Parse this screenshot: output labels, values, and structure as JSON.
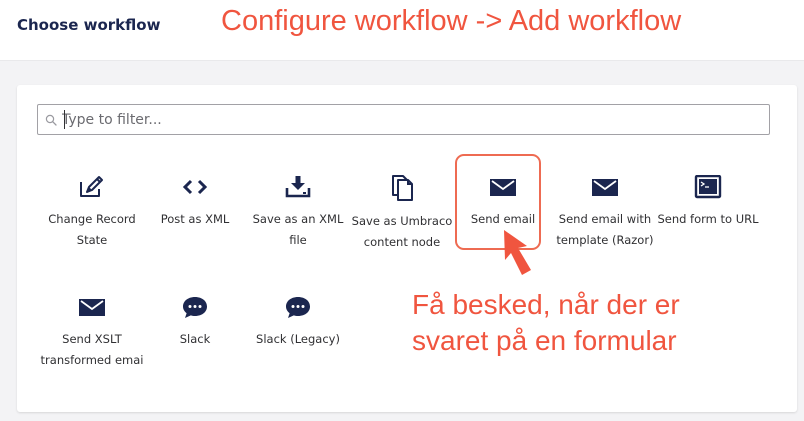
{
  "header": {
    "title": "Choose workflow"
  },
  "annotations": {
    "top": "Configure workflow -> Add workflow",
    "bottom_line1": "Få besked, når der er",
    "bottom_line2": "svaret på en formular"
  },
  "filter": {
    "placeholder": "Type to filter...",
    "value": "",
    "icon": "search-icon"
  },
  "workflows": [
    {
      "label_line1": "Change Record",
      "label_line2": "State",
      "icon": "edit-icon"
    },
    {
      "label_line1": "Post as XML",
      "label_line2": "",
      "icon": "code-icon"
    },
    {
      "label_line1": "Save as an XML",
      "label_line2": "file",
      "icon": "download-icon"
    },
    {
      "label_line1": "Save as Umbraco",
      "label_line2": "content node",
      "icon": "documents-icon"
    },
    {
      "label_line1": "Send email",
      "label_line2": "",
      "icon": "envelope-icon",
      "highlighted": true
    },
    {
      "label_line1": "Send email with",
      "label_line2": "template (Razor)",
      "icon": "envelope-icon"
    },
    {
      "label_line1": "Send form to URL",
      "label_line2": "",
      "icon": "terminal-icon"
    },
    {
      "label_line1": "Send XSLT",
      "label_line2": "transformed emai",
      "icon": "envelope-icon"
    },
    {
      "label_line1": "Slack",
      "label_line2": "",
      "icon": "chat-bubble-icon"
    },
    {
      "label_line1": "Slack (Legacy)",
      "label_line2": "",
      "icon": "chat-bubble-icon"
    }
  ],
  "colors": {
    "icon": "#1b264f",
    "annotation": "#f0553f",
    "highlight_border": "#ee6b52",
    "workspace_bg": "#f3f3f5"
  }
}
